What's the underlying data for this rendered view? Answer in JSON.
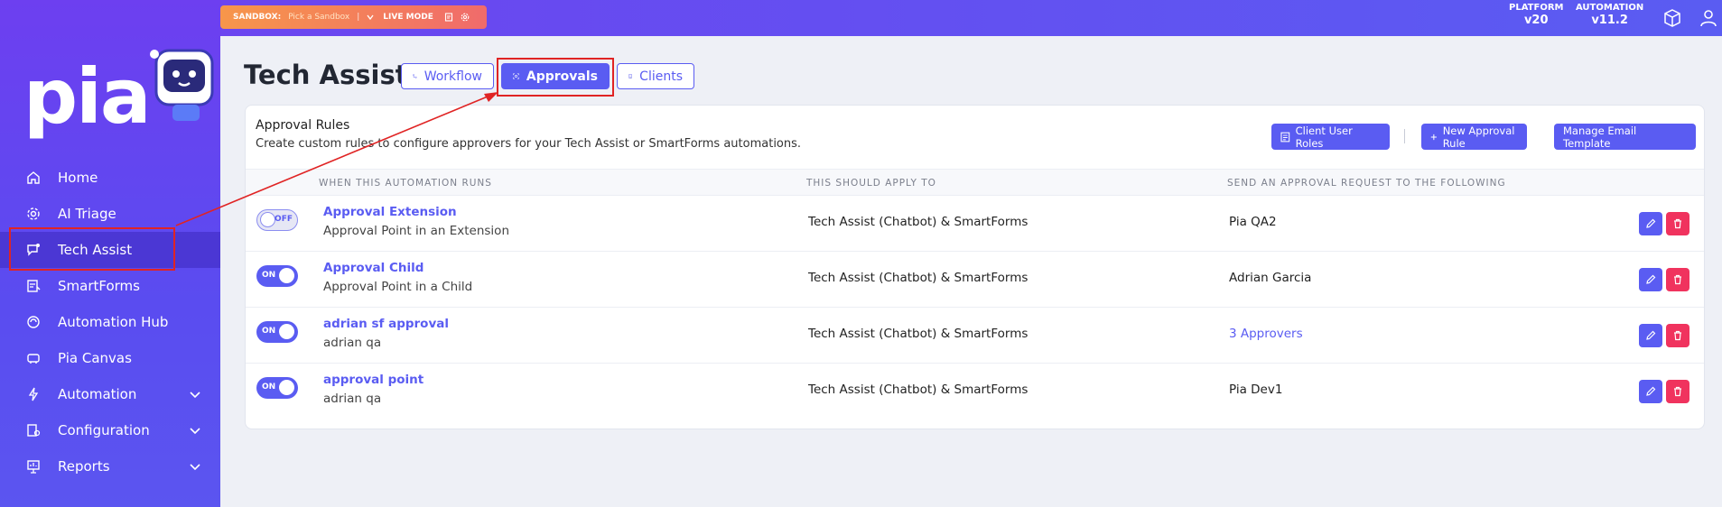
{
  "topbar": {
    "sandbox_label": "SANDBOX:",
    "sandbox_pick": "Pick a Sandbox",
    "live_mode": "LIVE MODE",
    "platform_label": "PLATFORM",
    "platform_version": "v20",
    "automation_label": "AUTOMATION",
    "automation_version": "v11.2"
  },
  "sidebar": {
    "logo": "pia",
    "items": [
      {
        "label": "Home",
        "icon": "home-icon"
      },
      {
        "label": "AI Triage",
        "icon": "gear-icon"
      },
      {
        "label": "Tech Assist",
        "icon": "chat-icon",
        "active": true
      },
      {
        "label": "SmartForms",
        "icon": "forms-icon"
      },
      {
        "label": "Automation Hub",
        "icon": "hub-icon"
      },
      {
        "label": "Pia Canvas",
        "icon": "canvas-icon"
      },
      {
        "label": "Automation",
        "icon": "bolt-icon",
        "expandable": true
      },
      {
        "label": "Configuration",
        "icon": "config-icon",
        "expandable": true
      },
      {
        "label": "Reports",
        "icon": "reports-icon",
        "expandable": true
      }
    ]
  },
  "page": {
    "title": "Tech Assist",
    "tabs": [
      {
        "label": "Workflow",
        "icon": "workflow-icon"
      },
      {
        "label": "Approvals",
        "icon": "approvals-icon",
        "active": true
      },
      {
        "label": "Clients",
        "icon": "clients-icon"
      }
    ]
  },
  "card": {
    "title": "Approval Rules",
    "subtitle": "Create custom rules to configure approvers for your Tech Assist or SmartForms automations.",
    "buttons": {
      "client_user_roles": "Client User Roles",
      "new_approval_rule": "New Approval Rule",
      "manage_email_template": "Manage Email Template"
    },
    "columns": {
      "runs": "WHEN THIS AUTOMATION RUNS",
      "apply": "THIS SHOULD APPLY TO",
      "send": "SEND AN APPROVAL REQUEST TO THE FOLLOWING"
    },
    "rows": [
      {
        "toggle": "OFF",
        "enabled": false,
        "name": "Approval Extension",
        "desc": "Approval Point in an Extension",
        "apply": "Tech Assist (Chatbot) & SmartForms",
        "send": "Pia QA2",
        "send_is_link": false
      },
      {
        "toggle": "ON",
        "enabled": true,
        "name": "Approval Child",
        "desc": "Approval Point in a Child",
        "apply": "Tech Assist (Chatbot) & SmartForms",
        "send": "Adrian Garcia",
        "send_is_link": false
      },
      {
        "toggle": "ON",
        "enabled": true,
        "name": "adrian sf approval",
        "desc": "adrian qa",
        "apply": "Tech Assist (Chatbot) & SmartForms",
        "send": "3 Approvers",
        "send_is_link": true
      },
      {
        "toggle": "ON",
        "enabled": true,
        "name": "approval point",
        "desc": "adrian qa",
        "apply": "Tech Assist (Chatbot) & SmartForms",
        "send": "Pia Dev1",
        "send_is_link": false
      }
    ]
  },
  "colors": {
    "accent": "#5a5cf2",
    "sidebar": "#6d3ff0",
    "danger": "#f0335e",
    "annotation": "#e02424"
  }
}
